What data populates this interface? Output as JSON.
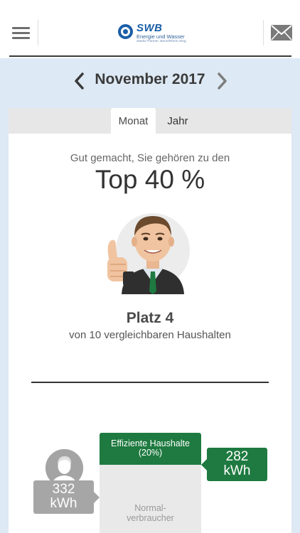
{
  "header": {
    "logo_brand": "SWB",
    "logo_subtitle": "Energie und Wasser",
    "logo_slogan": "Starke Partner. Bonn/Rhein-Sieg."
  },
  "period": {
    "label": "November 2017"
  },
  "tabs": [
    {
      "label": "Monat",
      "active": true
    },
    {
      "label": "Jahr",
      "active": false
    }
  ],
  "result": {
    "intro": "Gut gemacht, Sie gehören zu den",
    "top": "Top 40 %",
    "platz": "Platz 4",
    "platz_sub": "von 10 vergleichbaren Haushalten"
  },
  "comparison": {
    "efficient_label": "Effiziente Haushalte",
    "efficient_share": "(20%)",
    "efficient_value": "282",
    "efficient_unit": "kWh",
    "normal_label_1": "Normal-",
    "normal_label_2": "verbraucher",
    "user_value": "332",
    "user_unit": "kWh"
  },
  "colors": {
    "accent_green": "#1e7a40",
    "brand_blue": "#1a5fa8",
    "background_blue": "#dde9f4",
    "user_grey": "#a6a6a6"
  }
}
